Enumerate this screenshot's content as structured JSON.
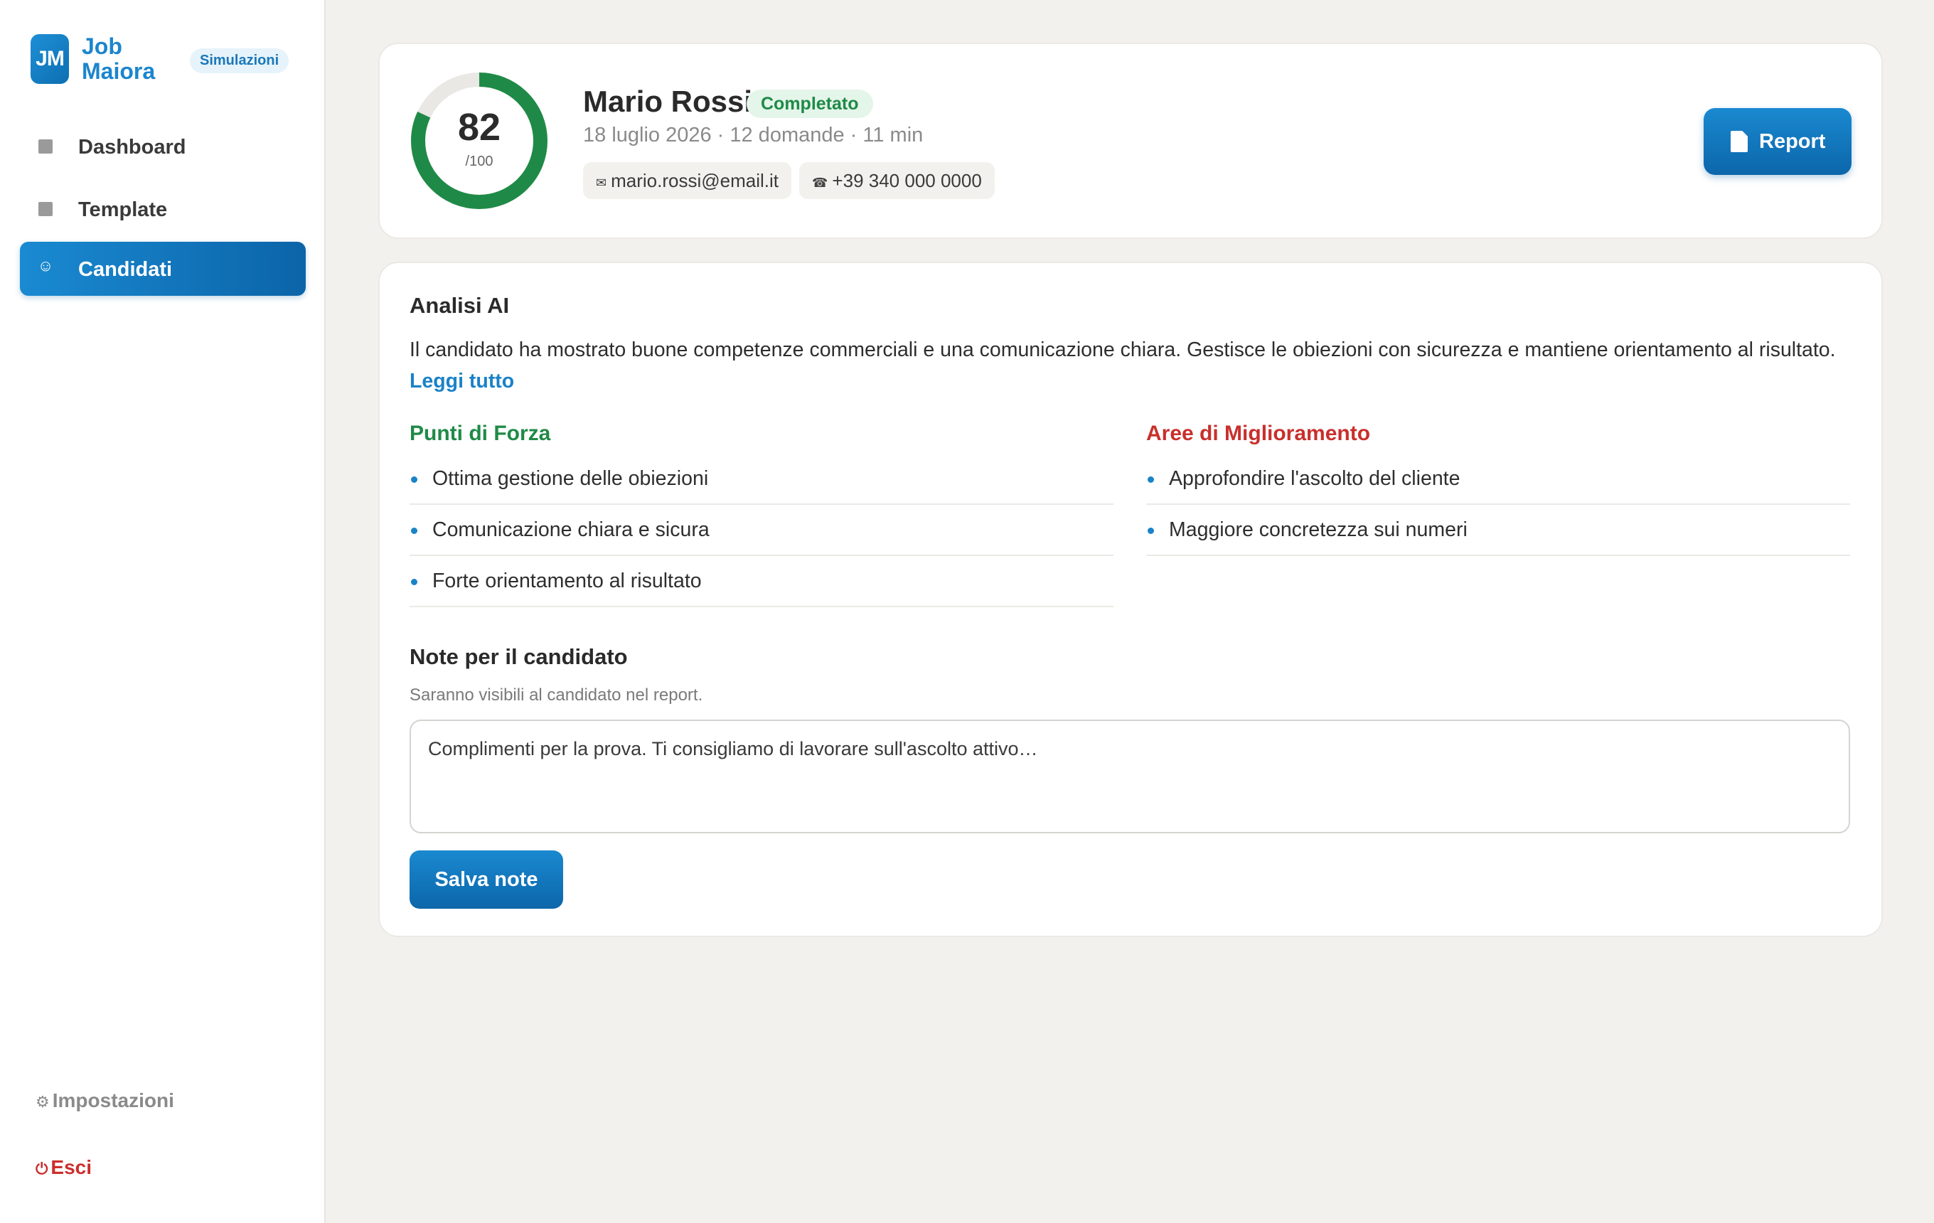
{
  "brand": {
    "logo_text": "JM",
    "name": "Job Maiora",
    "badge": "Simulazioni",
    "accent_color": "#1b86cc"
  },
  "sidebar": {
    "items": [
      {
        "label": "Dashboard",
        "icon": "square-icon",
        "active": false
      },
      {
        "label": "Template",
        "icon": "square-icon",
        "active": false
      },
      {
        "label": "Candidati",
        "icon": "smiley-icon",
        "active": true
      }
    ],
    "settings_label": "Impostazioni",
    "settings_icon": "gear-icon",
    "exit_label": "Esci",
    "exit_icon": "power-icon",
    "exit_color": "#cc2d2d"
  },
  "candidate": {
    "score": "82",
    "score_max": "/100",
    "score_fraction": 0.82,
    "name": "Mario Rossi",
    "status": "Completato",
    "meta": "18 luglio 2026 · 12 domande · 11 min",
    "email": "mario.rossi@email.it",
    "phone": "+39 340 000 0000",
    "report_button": "Report",
    "score_color": "#1f8a47",
    "status_color": "#1f8a47"
  },
  "analysis": {
    "title": "Analisi AI",
    "text": "Il candidato ha mostrato buone competenze commerciali e una comunicazione chiara. Gestisce le obiezioni con sicurezza e mantiene orientamento al risultato.",
    "read_more": "Leggi tutto",
    "strengths": {
      "title": "Punti di Forza",
      "color": "#1f8a47",
      "items": [
        "Ottima gestione delle obiezioni",
        "Comunicazione chiara e sicura",
        "Forte orientamento al risultato"
      ]
    },
    "improvements": {
      "title": "Aree di Miglioramento",
      "color": "#c8302c",
      "items": [
        "Approfondire l'ascolto del cliente",
        "Maggiore concretezza sui numeri"
      ]
    }
  },
  "notes": {
    "title": "Note per il candidato",
    "hint": "Saranno visibili al candidato nel report.",
    "value": "Complimenti per la prova. Ti consigliamo di lavorare sull'ascolto attivo…",
    "save_button": "Salva note"
  }
}
